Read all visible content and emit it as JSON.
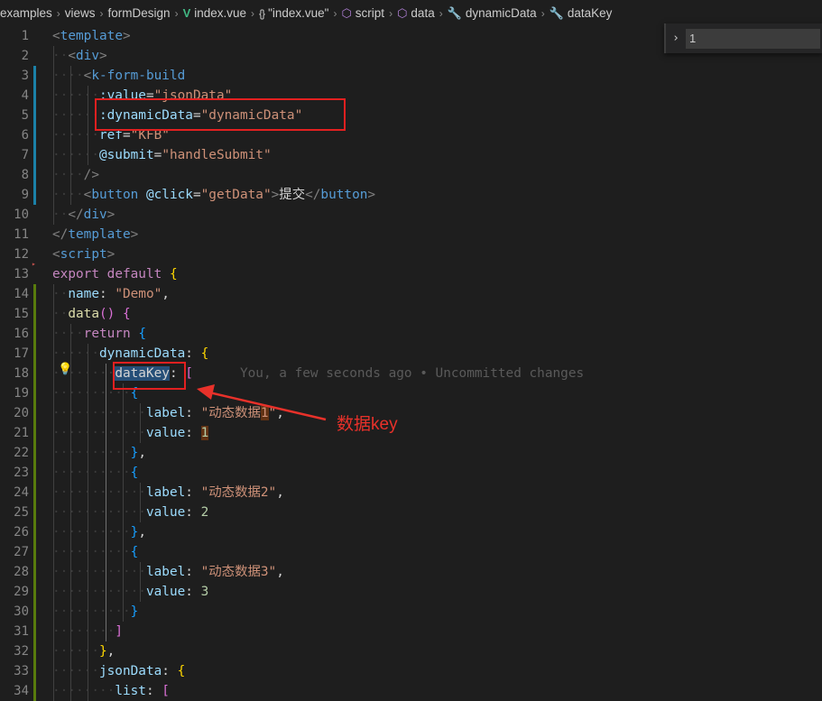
{
  "breadcrumb": {
    "items": [
      {
        "label": "examples",
        "icon": ""
      },
      {
        "label": "views",
        "icon": ""
      },
      {
        "label": "formDesign",
        "icon": ""
      },
      {
        "label": "index.vue",
        "icon": "vue-icon"
      },
      {
        "label": "\"index.vue\"",
        "icon": "braces-icon"
      },
      {
        "label": "script",
        "icon": "cube-icon"
      },
      {
        "label": "data",
        "icon": "cube-icon"
      },
      {
        "label": "dynamicData",
        "icon": "wrench-icon"
      },
      {
        "label": "dataKey",
        "icon": "wrench-icon"
      }
    ]
  },
  "find_widget": {
    "toggle": "›",
    "value": "1"
  },
  "lines": [
    {
      "num": "1",
      "indent": 0,
      "tokens": [
        [
          "tg",
          "<"
        ],
        [
          "tn",
          "template"
        ],
        [
          "tg",
          ">"
        ]
      ]
    },
    {
      "num": "2",
      "indent": 1,
      "tokens": [
        [
          "tg",
          "<"
        ],
        [
          "tn",
          "div"
        ],
        [
          "tg",
          ">"
        ]
      ]
    },
    {
      "num": "3",
      "indent": 2,
      "tokens": [
        [
          "tg",
          "<"
        ],
        [
          "tn",
          "k-form-build"
        ]
      ]
    },
    {
      "num": "4",
      "indent": 3,
      "tokens": [
        [
          "at",
          ":value"
        ],
        [
          "wt",
          "="
        ],
        [
          "st",
          "\"jsonData\""
        ]
      ]
    },
    {
      "num": "5",
      "indent": 3,
      "tokens": [
        [
          "at",
          ":dynamicData"
        ],
        [
          "wt",
          "="
        ],
        [
          "st",
          "\"dynamicData\""
        ]
      ]
    },
    {
      "num": "6",
      "indent": 3,
      "tokens": [
        [
          "at",
          "ref"
        ],
        [
          "wt",
          "="
        ],
        [
          "st",
          "\"KFB\""
        ]
      ]
    },
    {
      "num": "7",
      "indent": 3,
      "tokens": [
        [
          "at",
          "@submit"
        ],
        [
          "wt",
          "="
        ],
        [
          "st",
          "\"handleSubmit\""
        ]
      ]
    },
    {
      "num": "8",
      "indent": 2,
      "tokens": [
        [
          "tg",
          "/>"
        ]
      ]
    },
    {
      "num": "9",
      "indent": 2,
      "tokens": [
        [
          "tg",
          "<"
        ],
        [
          "tn",
          "button"
        ],
        [
          "wt",
          " "
        ],
        [
          "at",
          "@click"
        ],
        [
          "wt",
          "="
        ],
        [
          "st",
          "\"getData\""
        ],
        [
          "tg",
          ">"
        ],
        [
          "wt",
          "提交"
        ],
        [
          "tg",
          "</"
        ],
        [
          "tn",
          "button"
        ],
        [
          "tg",
          ">"
        ]
      ]
    },
    {
      "num": "10",
      "indent": 1,
      "tokens": [
        [
          "tg",
          "</"
        ],
        [
          "tn",
          "div"
        ],
        [
          "tg",
          ">"
        ]
      ]
    },
    {
      "num": "11",
      "indent": 0,
      "tokens": [
        [
          "tg",
          "</"
        ],
        [
          "tn",
          "template"
        ],
        [
          "tg",
          ">"
        ]
      ]
    },
    {
      "num": "12",
      "indent": 0,
      "tokens": [
        [
          "tg",
          "<"
        ],
        [
          "tn",
          "script"
        ],
        [
          "tg",
          ">"
        ]
      ]
    },
    {
      "num": "13",
      "indent": 0,
      "tokens": [
        [
          "pk",
          "export"
        ],
        [
          "wt",
          " "
        ],
        [
          "pk",
          "default"
        ],
        [
          "wt",
          " "
        ],
        [
          "b1",
          "{"
        ]
      ]
    },
    {
      "num": "14",
      "indent": 1,
      "tokens": [
        [
          "pr",
          "name"
        ],
        [
          "wt",
          ": "
        ],
        [
          "st",
          "\"Demo\""
        ],
        [
          "wt",
          ","
        ]
      ]
    },
    {
      "num": "15",
      "indent": 1,
      "tokens": [
        [
          "fn",
          "data"
        ],
        [
          "b2",
          "()"
        ],
        [
          "wt",
          " "
        ],
        [
          "b2",
          "{"
        ]
      ]
    },
    {
      "num": "16",
      "indent": 2,
      "tokens": [
        [
          "pk",
          "return"
        ],
        [
          "wt",
          " "
        ],
        [
          "b3",
          "{"
        ]
      ]
    },
    {
      "num": "17",
      "indent": 3,
      "tokens": [
        [
          "pr",
          "dynamicData"
        ],
        [
          "wt",
          ": "
        ],
        [
          "b1",
          "{"
        ]
      ]
    },
    {
      "num": "18",
      "indent": 4,
      "tokens": [
        [
          "sel",
          "dataKey"
        ],
        [
          "wt",
          ": "
        ],
        [
          "b2",
          "["
        ],
        [
          "blame",
          "      You, a few seconds ago • Uncommitted changes"
        ]
      ]
    },
    {
      "num": "19",
      "indent": 5,
      "tokens": [
        [
          "b3",
          "{"
        ]
      ]
    },
    {
      "num": "20",
      "indent": 6,
      "tokens": [
        [
          "pr",
          "label"
        ],
        [
          "wt",
          ": "
        ],
        [
          "st",
          "\"动态数据"
        ],
        [
          "sthl",
          "1"
        ],
        [
          "st",
          "\""
        ],
        [
          "wt",
          ","
        ]
      ]
    },
    {
      "num": "21",
      "indent": 6,
      "tokens": [
        [
          "pr",
          "value"
        ],
        [
          "wt",
          ": "
        ],
        [
          "nmhl",
          "1"
        ]
      ]
    },
    {
      "num": "22",
      "indent": 5,
      "tokens": [
        [
          "b3",
          "}"
        ],
        [
          "wt",
          ","
        ]
      ]
    },
    {
      "num": "23",
      "indent": 5,
      "tokens": [
        [
          "b3",
          "{"
        ]
      ]
    },
    {
      "num": "24",
      "indent": 6,
      "tokens": [
        [
          "pr",
          "label"
        ],
        [
          "wt",
          ": "
        ],
        [
          "st",
          "\"动态数据2\""
        ],
        [
          "wt",
          ","
        ]
      ]
    },
    {
      "num": "25",
      "indent": 6,
      "tokens": [
        [
          "pr",
          "value"
        ],
        [
          "wt",
          ": "
        ],
        [
          "nm",
          "2"
        ]
      ]
    },
    {
      "num": "26",
      "indent": 5,
      "tokens": [
        [
          "b3",
          "}"
        ],
        [
          "wt",
          ","
        ]
      ]
    },
    {
      "num": "27",
      "indent": 5,
      "tokens": [
        [
          "b3",
          "{"
        ]
      ]
    },
    {
      "num": "28",
      "indent": 6,
      "tokens": [
        [
          "pr",
          "label"
        ],
        [
          "wt",
          ": "
        ],
        [
          "st",
          "\"动态数据3\""
        ],
        [
          "wt",
          ","
        ]
      ]
    },
    {
      "num": "29",
      "indent": 6,
      "tokens": [
        [
          "pr",
          "value"
        ],
        [
          "wt",
          ": "
        ],
        [
          "nm",
          "3"
        ]
      ]
    },
    {
      "num": "30",
      "indent": 5,
      "tokens": [
        [
          "b3",
          "}"
        ]
      ]
    },
    {
      "num": "31",
      "indent": 4,
      "tokens": [
        [
          "b2",
          "]"
        ]
      ]
    },
    {
      "num": "32",
      "indent": 3,
      "tokens": [
        [
          "b1",
          "}"
        ],
        [
          "wt",
          ","
        ]
      ]
    },
    {
      "num": "33",
      "indent": 3,
      "tokens": [
        [
          "pr",
          "jsonData"
        ],
        [
          "wt",
          ": "
        ],
        [
          "b1",
          "{"
        ]
      ]
    },
    {
      "num": "34",
      "indent": 4,
      "tokens": [
        [
          "pr",
          "list"
        ],
        [
          "wt",
          ": "
        ],
        [
          "b2",
          "["
        ]
      ]
    }
  ],
  "annotation": {
    "label": "数据key",
    "color": "#e8312a"
  },
  "colors": {
    "background": "#1e1e1e",
    "modified_bar": "#1b81a8",
    "added_bar": "#587c0c",
    "red_box": "#e32020"
  }
}
